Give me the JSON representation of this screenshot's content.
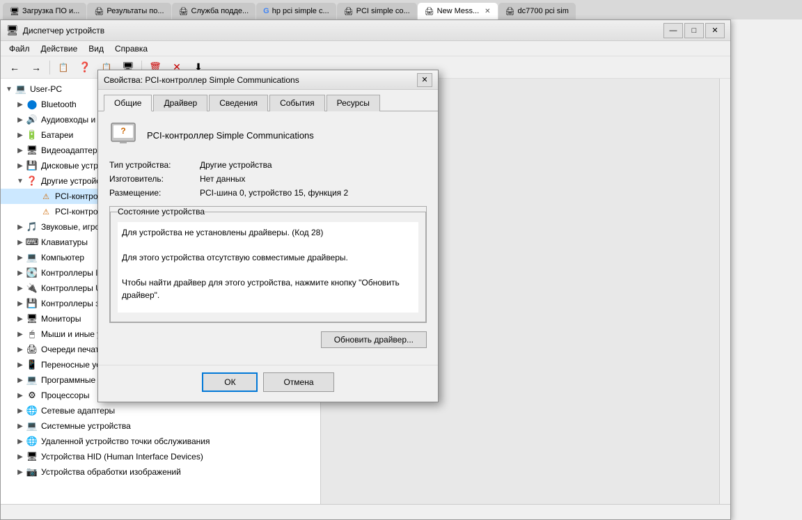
{
  "browser": {
    "tabs": [
      {
        "label": "Загрузка ПО и...",
        "icon": "🖥",
        "active": false,
        "hasClose": false
      },
      {
        "label": "Результаты по...",
        "icon": "🖨",
        "active": false,
        "hasClose": false
      },
      {
        "label": "Служба подде...",
        "icon": "🖨",
        "active": false,
        "hasClose": false
      },
      {
        "label": "hp pci simple c...",
        "icon": "G",
        "active": false,
        "hasClose": false
      },
      {
        "label": "PCI simple co...",
        "icon": "🖨",
        "active": false,
        "hasClose": false
      },
      {
        "label": "New Mess...",
        "icon": "🖨",
        "active": true,
        "hasClose": true
      },
      {
        "label": "dc7700 pci sim",
        "icon": "🖨",
        "active": false,
        "hasClose": false
      }
    ]
  },
  "window": {
    "title": "Диспетчер устройств",
    "icon": "🖥"
  },
  "menu": {
    "items": [
      "Файл",
      "Действие",
      "Вид",
      "Справка"
    ]
  },
  "toolbar": {
    "buttons": [
      "←",
      "→",
      "📋",
      "📋",
      "❓",
      "📋",
      "🖥",
      "🗑",
      "✕",
      "⬇"
    ]
  },
  "tree": {
    "items": [
      {
        "level": 0,
        "toggle": "▼",
        "icon": "💻",
        "label": "User-PC"
      },
      {
        "level": 1,
        "toggle": "▶",
        "icon": "🔵",
        "label": "Bluetooth"
      },
      {
        "level": 1,
        "toggle": "▶",
        "icon": "🔊",
        "label": "Аудиовходы и аудиовыходы"
      },
      {
        "level": 1,
        "toggle": "▶",
        "icon": "🔋",
        "label": "Батареи"
      },
      {
        "level": 1,
        "toggle": "▶",
        "icon": "🖥",
        "label": "Видеоадаптеры"
      },
      {
        "level": 1,
        "toggle": "▶",
        "icon": "💾",
        "label": "Дисковые устройства"
      },
      {
        "level": 1,
        "toggle": "▼",
        "icon": "❓",
        "label": "Другие устройства"
      },
      {
        "level": 2,
        "toggle": "",
        "icon": "⚠",
        "label": "PCI-контроллер Simple Communications"
      },
      {
        "level": 2,
        "toggle": "",
        "icon": "⚠",
        "label": "PCI-контроллер Simple Communications"
      },
      {
        "level": 1,
        "toggle": "▶",
        "icon": "🔊",
        "label": "Звуковые, игровые и видеоустройства"
      },
      {
        "level": 1,
        "toggle": "▶",
        "icon": "⌨",
        "label": "Клавиатуры"
      },
      {
        "level": 1,
        "toggle": "▶",
        "icon": "💻",
        "label": "Компьютер"
      },
      {
        "level": 1,
        "toggle": "▶",
        "icon": "💽",
        "label": "Контроллеры IDE ATA/ATAPI"
      },
      {
        "level": 1,
        "toggle": "▶",
        "icon": "🔌",
        "label": "Контроллеры USB"
      },
      {
        "level": 1,
        "toggle": "▶",
        "icon": "💾",
        "label": "Контроллеры запоминающих устройств"
      },
      {
        "level": 1,
        "toggle": "▶",
        "icon": "🖥",
        "label": "Мониторы"
      },
      {
        "level": 1,
        "toggle": "▶",
        "icon": "🖱",
        "label": "Мыши и иные указывающие устройства"
      },
      {
        "level": 1,
        "toggle": "▶",
        "icon": "🖨",
        "label": "Очереди печати"
      },
      {
        "level": 1,
        "toggle": "▶",
        "icon": "📱",
        "label": "Переносные устройства"
      },
      {
        "level": 1,
        "toggle": "▶",
        "icon": "💻",
        "label": "Программные устройства"
      },
      {
        "level": 1,
        "toggle": "▶",
        "icon": "⚙",
        "label": "Процессоры"
      },
      {
        "level": 1,
        "toggle": "▶",
        "icon": "🌐",
        "label": "Сетевые адаптеры"
      },
      {
        "level": 1,
        "toggle": "▶",
        "icon": "💻",
        "label": "Системные устройства"
      },
      {
        "level": 1,
        "toggle": "▶",
        "icon": "🌐",
        "label": "Удаленной устройство точки обслуживания"
      },
      {
        "level": 1,
        "toggle": "▶",
        "icon": "🖥",
        "label": "Устройства HID (Human Interface Devices)"
      },
      {
        "level": 1,
        "toggle": "▶",
        "icon": "📷",
        "label": "Устройства обработки изображений"
      }
    ]
  },
  "dialog": {
    "title": "Свойства: PCI-контроллер Simple Communications",
    "tabs": [
      "Общие",
      "Драйвер",
      "Сведения",
      "События",
      "Ресурсы"
    ],
    "active_tab": "Общие",
    "device_name": "PCI-контроллер Simple Communications",
    "properties": [
      {
        "label": "Тип устройства:",
        "value": "Другие устройства"
      },
      {
        "label": "Изготовитель:",
        "value": "Нет данных"
      },
      {
        "label": "Размещение:",
        "value": "PCI-шина 0, устройство 15, функция 2"
      }
    ],
    "status_group_label": "Состояние устройства",
    "status_text": "Для устройства не установлены драйверы. (Код 28)\n\nДля этого устройства отсутствую совместимые драйверы.\n\nЧтобы найти драйвер для этого устройства, нажмите кнопку \"Обновить драйвер\".",
    "update_btn": "Обновить драйвер...",
    "ok_btn": "ОК",
    "cancel_btn": "Отмена"
  }
}
